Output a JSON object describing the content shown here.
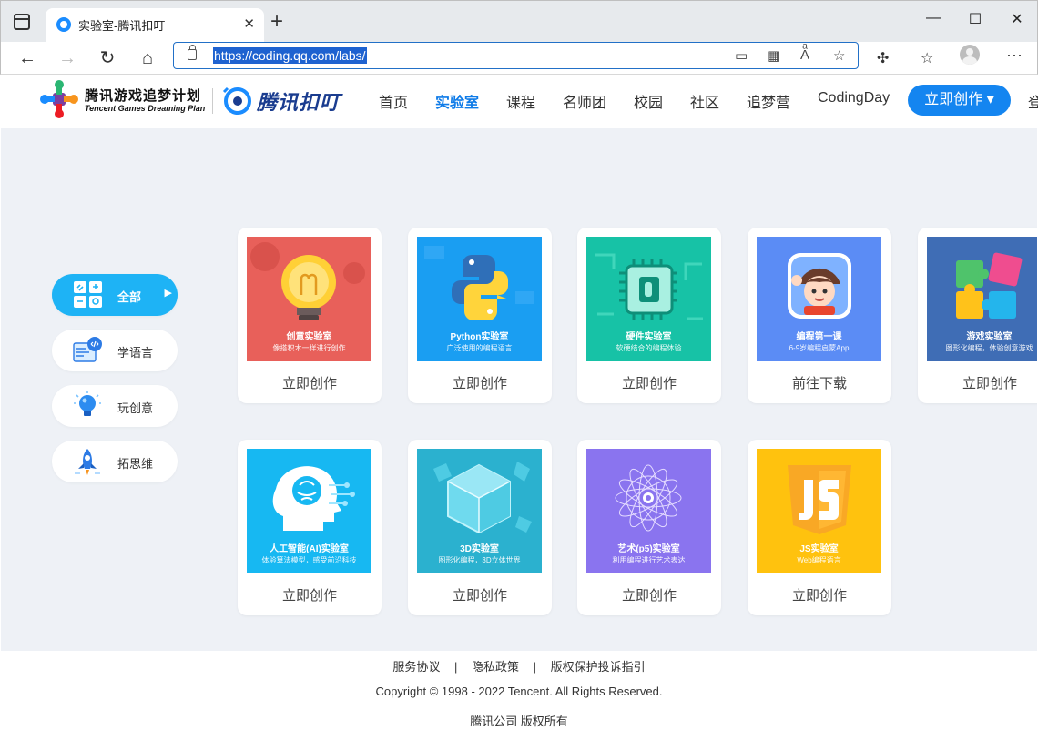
{
  "browser": {
    "tab_title": "实验室-腾讯扣叮",
    "url": "https://coding.qq.com/labs/",
    "win_minimize": "—",
    "win_maximize": "☐",
    "win_close": "✕"
  },
  "header": {
    "logo_title": "腾讯游戏追梦计划",
    "logo_subtitle": "Tencent Games Dreaming Plan",
    "brand_name": "腾讯扣叮",
    "nav": [
      {
        "label": "首页"
      },
      {
        "label": "实验室",
        "active": true
      },
      {
        "label": "课程"
      },
      {
        "label": "名师团"
      },
      {
        "label": "校园"
      },
      {
        "label": "社区"
      },
      {
        "label": "追梦营"
      },
      {
        "label": "CodingDay"
      }
    ],
    "create_button": "立即创作 ▾",
    "login_partial": "登"
  },
  "sidebar": {
    "items": [
      {
        "label": "全部",
        "icon": "grid-icon",
        "active": true
      },
      {
        "label": "学语言",
        "icon": "code-window-icon"
      },
      {
        "label": "玩创意",
        "icon": "lightbulb-icon"
      },
      {
        "label": "拓思维",
        "icon": "rocket-icon"
      }
    ]
  },
  "labs": [
    {
      "name": "创意实验室",
      "desc": "像搭积木一样进行创作",
      "action": "立即创作",
      "color": "#e8605a",
      "icon": "lightbulb-icon"
    },
    {
      "name": "Python实验室",
      "desc": "广泛使用的编程语言",
      "action": "立即创作",
      "color": "#1a9ef2",
      "icon": "python-icon"
    },
    {
      "name": "硬件实验室",
      "desc": "软硬结合的编程体验",
      "action": "立即创作",
      "color": "#17c2a6",
      "icon": "chip-icon"
    },
    {
      "name": "编程第一课",
      "desc": "6-9岁编程启蒙App",
      "action": "前往下载",
      "color": "#5b8cf5",
      "icon": "character-icon"
    },
    {
      "name": "游戏实验室",
      "desc": "图形化编程，体验创意游戏",
      "action": "立即创作",
      "color": "#3f6db5",
      "icon": "puzzle-icon"
    },
    {
      "name": "人工智能(AI)实验室",
      "desc": "体验算法模型，感受前沿科技",
      "action": "立即创作",
      "color": "#17b8f2",
      "icon": "ai-head-icon"
    },
    {
      "name": "3D实验室",
      "desc": "图形化编程，3D立体世界",
      "action": "立即创作",
      "color": "#2bb1cf",
      "icon": "cube-icon"
    },
    {
      "name": "艺术(p5)实验室",
      "desc": "利用编程进行艺术表达",
      "action": "立即创作",
      "color": "#8a74ef",
      "icon": "flower-pattern-icon"
    },
    {
      "name": "JS实验室",
      "desc": "Web编程语言",
      "action": "立即创作",
      "color": "#ffc20e",
      "icon": "js-shield-icon"
    }
  ],
  "footer": {
    "links": [
      "服务协议",
      "隐私政策",
      "版权保护投诉指引"
    ],
    "separator": "|",
    "copyright": "Copyright © 1998 - 2022 Tencent. All Rights Reserved.",
    "company": "腾讯公司 版权所有"
  }
}
